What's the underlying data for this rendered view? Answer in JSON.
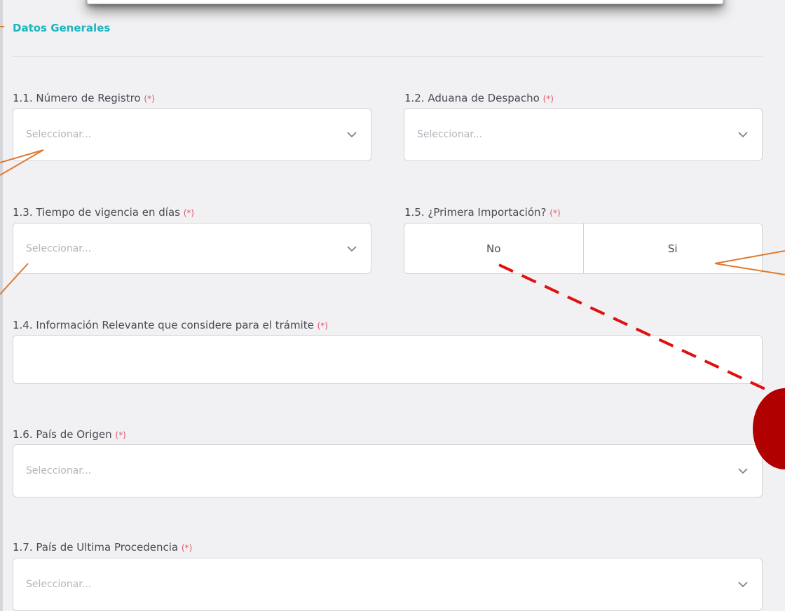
{
  "section": {
    "title": "Datos Generales"
  },
  "fields": {
    "registro": {
      "label": "1.1. Número de Registro",
      "required": "(*)",
      "placeholder": "Seleccionar..."
    },
    "aduana": {
      "label": "1.2. Aduana de Despacho",
      "required": "(*)",
      "placeholder": "Seleccionar..."
    },
    "vigencia": {
      "label": "1.3. Tiempo de vigencia en días",
      "required": "(*)",
      "placeholder": "Seleccionar..."
    },
    "primera_importacion": {
      "label": "1.5. ¿Primera Importación?",
      "required": "(*)",
      "options": [
        "No",
        "Si"
      ]
    },
    "informacion": {
      "label": "1.4. Información Relevante que considere para el trámite",
      "required": "(*)",
      "value": ""
    },
    "pais_origen": {
      "label": "1.6. País de Origen",
      "required": "(*)",
      "placeholder": "Seleccionar..."
    },
    "pais_procedencia": {
      "label": "1.7. País de Ultima Procedencia",
      "required": "(*)",
      "placeholder": "Seleccionar..."
    }
  },
  "colors": {
    "section_title": "#1fb4be",
    "required_marker": "#e0566a",
    "annotation_arrow": "#e07a30",
    "annotation_dashed_line": "#e01010",
    "annotation_marker": "#b00000"
  },
  "icons": {
    "select_chevron": "chevron-down-icon"
  }
}
